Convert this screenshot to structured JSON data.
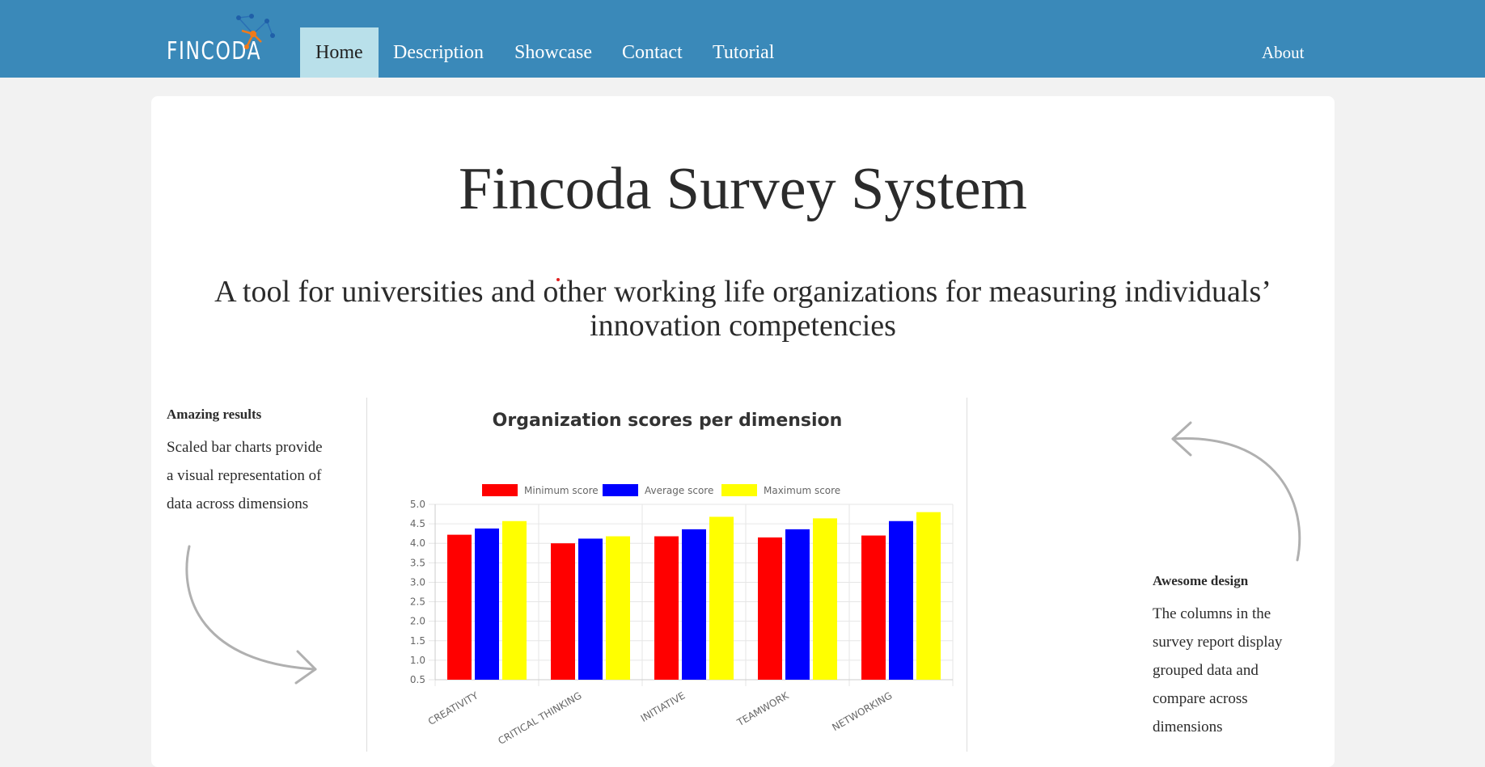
{
  "brand": {
    "logo_text": "FINCODA"
  },
  "nav": {
    "items": [
      {
        "label": "Home",
        "active": true
      },
      {
        "label": "Description"
      },
      {
        "label": "Showcase"
      },
      {
        "label": "Contact"
      },
      {
        "label": "Tutorial"
      }
    ],
    "right_item": {
      "label": "About"
    }
  },
  "hero": {
    "title": "Fincoda Survey System",
    "subtitle": "A tool for universities and other working life organizations for measuring individuals’ innovation competencies"
  },
  "features": {
    "left": {
      "heading": "Amazing results",
      "lines": [
        "Scaled bar charts provide",
        "a visual representation of",
        "data across dimensions"
      ]
    },
    "right": {
      "heading": "Awesome design",
      "lines": [
        "The columns in the",
        "survey report display",
        "grouped data and",
        "compare across",
        "dimensions"
      ]
    }
  },
  "colors": {
    "navbar": "#3a89b9",
    "nav_active": "#b9e0ea",
    "series_min": "#ff0000",
    "series_avg": "#0000ff",
    "series_max": "#ffff00"
  },
  "chart_data": {
    "type": "bar",
    "title": "Organization scores per dimension",
    "categories": [
      "CREATIVITY",
      "CRITICAL THINKING",
      "INITIATIVE",
      "TEAMWORK",
      "NETWORKING"
    ],
    "series": [
      {
        "name": "Minimum score",
        "color": "#ff0000",
        "values": [
          4.22,
          4.0,
          4.18,
          4.15,
          4.2
        ]
      },
      {
        "name": "Average score",
        "color": "#0000ff",
        "values": [
          4.38,
          4.12,
          4.36,
          4.36,
          4.57
        ]
      },
      {
        "name": "Maximum score",
        "color": "#ffff00",
        "values": [
          4.57,
          4.18,
          4.68,
          4.64,
          4.8
        ]
      }
    ],
    "ylim": [
      0.5,
      5.0
    ],
    "yticks": [
      "5.0",
      "4.5",
      "4.0",
      "3.5",
      "3.0",
      "2.5",
      "2.0",
      "1.5",
      "1.0",
      "0.5"
    ],
    "xlabel": "",
    "ylabel": "",
    "legend_position": "top",
    "grid": true
  }
}
